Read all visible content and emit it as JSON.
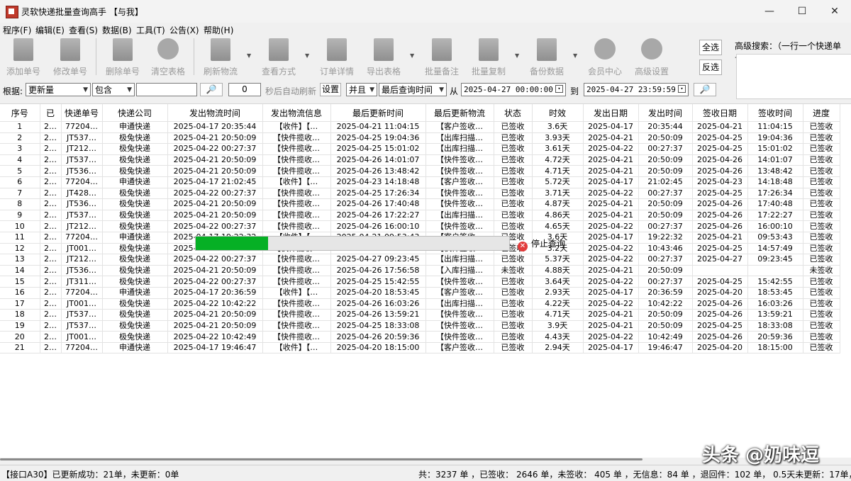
{
  "window": {
    "title": "灵软快递批量查询高手 【与我】",
    "minimize": "—",
    "maximize": "☐",
    "close": "✕"
  },
  "menu": [
    "程序(F)",
    "编辑(E)",
    "查看(S)",
    "数据(B)",
    "工具(T)",
    "公告(X)",
    "帮助(H)"
  ],
  "toolbar": {
    "add": "添加单号",
    "edit": "修改单号",
    "delete": "删除单号",
    "clear": "清空表格",
    "refresh": "刷新物流",
    "view_mode": "查看方式",
    "order_detail": "订单详情",
    "export": "导出表格",
    "batch_note": "批量备注",
    "batch_copy": "批量复制",
    "backup": "备份数据",
    "member": "会员中心",
    "advanced": "高级设置",
    "select_all": "全选",
    "invert": "反选",
    "adv_search_label": "高级搜索：（一行一个快递单号）"
  },
  "filter": {
    "basis_label": "根据:",
    "basis_value": "更新量",
    "match_value": "包含",
    "search_value": "",
    "search_icon": "🔎",
    "interval_value": "0",
    "auto_refresh_label": "秒后自动刷新",
    "settings_button": "设置",
    "logic_value": "并且",
    "time_field_value": "最后查询时间",
    "from_label": "从",
    "from_value": "2025-04-27 00:00:00",
    "to_label": "到",
    "to_value": "2025-04-27 23:59:59",
    "query_icon": "🔎"
  },
  "table": {
    "headers": [
      "序号",
      "已",
      "快递单号",
      "快递公司",
      "发出物流时间",
      "发出物流信息",
      "最后更新时间",
      "最后更新物流",
      "状态",
      "时效",
      "发出日期",
      "发出时间",
      "签收日期",
      "签收时间",
      "进度"
    ],
    "rows": [
      [
        "1",
        "2…",
        "77204…",
        "申通快递",
        "2025-04-17 20:35:44",
        "【收件】【…",
        "2025-04-21 11:04:15",
        "【客户签收…",
        "已签收",
        "3.6天",
        "2025-04-17",
        "20:35:44",
        "2025-04-21",
        "11:04:15",
        "已签收"
      ],
      [
        "2",
        "2…",
        "JT537…",
        "极兔快递",
        "2025-04-21 20:50:09",
        "【快件揽收…",
        "2025-04-25 19:04:36",
        "【出库扫描…",
        "已签收",
        "3.93天",
        "2025-04-21",
        "20:50:09",
        "2025-04-25",
        "19:04:36",
        "已签收"
      ],
      [
        "3",
        "2…",
        "JT212…",
        "极兔快递",
        "2025-04-22 00:27:37",
        "【快件揽收…",
        "2025-04-25 15:01:02",
        "【出库扫描…",
        "已签收",
        "3.61天",
        "2025-04-22",
        "00:27:37",
        "2025-04-25",
        "15:01:02",
        "已签收"
      ],
      [
        "4",
        "2…",
        "JT537…",
        "极兔快递",
        "2025-04-21 20:50:09",
        "【快件揽收…",
        "2025-04-26 14:01:07",
        "【快件签收…",
        "已签收",
        "4.72天",
        "2025-04-21",
        "20:50:09",
        "2025-04-26",
        "14:01:07",
        "已签收"
      ],
      [
        "5",
        "2…",
        "JT536…",
        "极兔快递",
        "2025-04-21 20:50:09",
        "【快件揽收…",
        "2025-04-26 13:48:42",
        "【快件签收…",
        "已签收",
        "4.71天",
        "2025-04-21",
        "20:50:09",
        "2025-04-26",
        "13:48:42",
        "已签收"
      ],
      [
        "6",
        "2…",
        "77204…",
        "申通快递",
        "2025-04-17 21:02:45",
        "【收件】【…",
        "2025-04-23 14:18:48",
        "【客户签收…",
        "已签收",
        "5.72天",
        "2025-04-17",
        "21:02:45",
        "2025-04-23",
        "14:18:48",
        "已签收"
      ],
      [
        "7",
        "2…",
        "JT428…",
        "极兔快递",
        "2025-04-22 00:27:37",
        "【快件揽收…",
        "2025-04-25 17:26:34",
        "【快件签收…",
        "已签收",
        "3.71天",
        "2025-04-22",
        "00:27:37",
        "2025-04-25",
        "17:26:34",
        "已签收"
      ],
      [
        "8",
        "2…",
        "JT536…",
        "极兔快递",
        "2025-04-21 20:50:09",
        "【快件揽收…",
        "2025-04-26 17:40:48",
        "【快件签收…",
        "已签收",
        "4.87天",
        "2025-04-21",
        "20:50:09",
        "2025-04-26",
        "17:40:48",
        "已签收"
      ],
      [
        "9",
        "2…",
        "JT537…",
        "极兔快递",
        "2025-04-21 20:50:09",
        "【快件揽收…",
        "2025-04-26 17:22:27",
        "【出库扫描…",
        "已签收",
        "4.86天",
        "2025-04-21",
        "20:50:09",
        "2025-04-26",
        "17:22:27",
        "已签收"
      ],
      [
        "10",
        "2…",
        "JT212…",
        "极兔快递",
        "2025-04-22 00:27:37",
        "【快件揽收…",
        "2025-04-26 16:00:10",
        "【快件签收…",
        "已签收",
        "4.65天",
        "2025-04-22",
        "00:27:37",
        "2025-04-26",
        "16:00:10",
        "已签收"
      ],
      [
        "11",
        "2…",
        "77204…",
        "申通快递",
        "2025-04-17 19:22:32",
        "【收件】【…",
        "2025-04-21 09:53:43",
        "【客户签收…",
        "已签收",
        "3.6天",
        "2025-04-17",
        "19:22:32",
        "2025-04-21",
        "09:53:43",
        "已签收"
      ],
      [
        "12",
        "2…",
        "JT001…",
        "极兔快递",
        "2025-04-22 10:43:46",
        "【快件揽收…",
        "2025-04-25 14:57:49",
        "【快件签收…",
        "已签收",
        "3.2天",
        "2025-04-22",
        "10:43:46",
        "2025-04-25",
        "14:57:49",
        "已签收"
      ],
      [
        "13",
        "2…",
        "JT212…",
        "极兔快递",
        "2025-04-22 00:27:37",
        "【快件揽收…",
        "2025-04-27 09:23:45",
        "【出库扫描…",
        "已签收",
        "5.37天",
        "2025-04-22",
        "00:27:37",
        "2025-04-27",
        "09:23:45",
        "已签收"
      ],
      [
        "14",
        "2…",
        "JT536…",
        "极兔快递",
        "2025-04-21 20:50:09",
        "【快件揽收…",
        "2025-04-26 17:56:58",
        "【入库扫描…",
        "未签收",
        "4.88天",
        "2025-04-21",
        "20:50:09",
        "",
        "",
        "未签收"
      ],
      [
        "15",
        "2…",
        "JT311…",
        "极兔快递",
        "2025-04-22 00:27:37",
        "【快件揽收…",
        "2025-04-25 15:42:55",
        "【快件签收…",
        "已签收",
        "3.64天",
        "2025-04-22",
        "00:27:37",
        "2025-04-25",
        "15:42:55",
        "已签收"
      ],
      [
        "16",
        "2…",
        "77204…",
        "申通快递",
        "2025-04-17 20:36:59",
        "【收件】【…",
        "2025-04-20 18:53:45",
        "【客户签收…",
        "已签收",
        "2.93天",
        "2025-04-17",
        "20:36:59",
        "2025-04-20",
        "18:53:45",
        "已签收"
      ],
      [
        "17",
        "2…",
        "JT001…",
        "极兔快递",
        "2025-04-22 10:42:22",
        "【快件揽收…",
        "2025-04-26 16:03:26",
        "【出库扫描…",
        "已签收",
        "4.22天",
        "2025-04-22",
        "10:42:22",
        "2025-04-26",
        "16:03:26",
        "已签收"
      ],
      [
        "18",
        "2…",
        "JT537…",
        "极兔快递",
        "2025-04-21 20:50:09",
        "【快件揽收…",
        "2025-04-26 13:59:21",
        "【快件签收…",
        "已签收",
        "4.71天",
        "2025-04-21",
        "20:50:09",
        "2025-04-26",
        "13:59:21",
        "已签收"
      ],
      [
        "19",
        "2…",
        "JT537…",
        "极兔快递",
        "2025-04-21 20:50:09",
        "【快件揽收…",
        "2025-04-25 18:33:08",
        "【快件签收…",
        "已签收",
        "3.9天",
        "2025-04-21",
        "20:50:09",
        "2025-04-25",
        "18:33:08",
        "已签收"
      ],
      [
        "20",
        "2…",
        "JT001…",
        "极兔快递",
        "2025-04-22 10:42:49",
        "【快件揽收…",
        "2025-04-26 20:59:36",
        "【快件签收…",
        "已签收",
        "4.43天",
        "2025-04-22",
        "10:42:49",
        "2025-04-26",
        "20:59:36",
        "已签收"
      ],
      [
        "21",
        "2…",
        "77204…",
        "申通快递",
        "2025-04-17 19:46:47",
        "【收件】【…",
        "2025-04-20 18:15:00",
        "【客户签收…",
        "已签收",
        "2.94天",
        "2025-04-17",
        "19:46:47",
        "2025-04-20",
        "18:15:00",
        "已签收"
      ]
    ]
  },
  "progress": {
    "fraction": 0.23,
    "stop_label": "停止查询",
    "fill_color": "#06b025"
  },
  "status": {
    "left": "【接口A30】已更新成功：21单，未更新：0单",
    "right": "共：3237 单 ，已签收： 2646 单，未签收： 405 单 ，无信息：84 单 ，退回件：102 单， 0.5天未更新：17单，1天"
  },
  "watermark": "头条 @奶味逗"
}
